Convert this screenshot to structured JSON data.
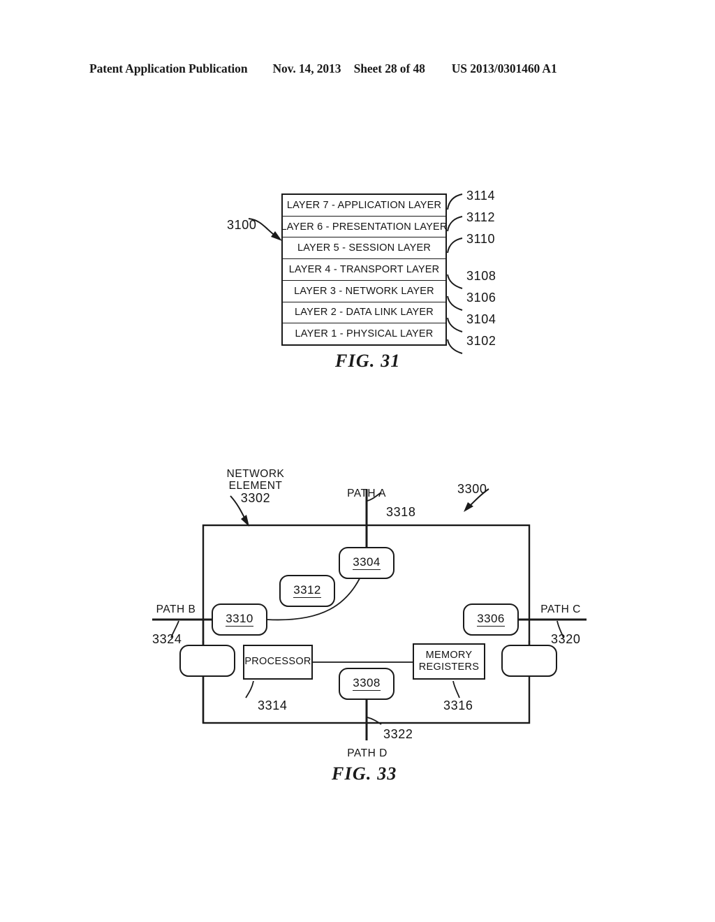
{
  "header": {
    "left": "Patent Application Publication",
    "date": "Nov. 14, 2013",
    "sheet": "Sheet 28 of 48",
    "number": "US 2013/0301460 A1"
  },
  "fig31": {
    "caption": "FIG. 31",
    "stack_ref": "3100",
    "layers": [
      {
        "label": "LAYER 7 - APPLICATION LAYER",
        "ref": "3114"
      },
      {
        "label": "LAYER 6 - PRESENTATION LAYER",
        "ref": "3112"
      },
      {
        "label": "LAYER 5 - SESSION LAYER",
        "ref": "3110"
      },
      {
        "label": "LAYER 4 - TRANSPORT LAYER",
        "ref": "3108"
      },
      {
        "label": "LAYER 3 - NETWORK LAYER",
        "ref": "3106"
      },
      {
        "label": "LAYER 2 - DATA LINK LAYER",
        "ref": "3104"
      },
      {
        "label": "LAYER 1 - PHYSICAL LAYER",
        "ref": "3102"
      }
    ]
  },
  "fig33": {
    "caption": "FIG. 33",
    "system_ref": "3300",
    "network_element": {
      "line1": "NETWORK",
      "line2": "ELEMENT",
      "ref": "3302"
    },
    "nodes": {
      "top": "3304",
      "right": "3306",
      "bottom": "3308",
      "left": "3310",
      "center": "3312"
    },
    "blocks": {
      "processor": {
        "label": "PROCESSOR",
        "ref": "3314"
      },
      "memory": {
        "line1": "MEMORY",
        "line2": "REGISTERS",
        "ref": "3316"
      }
    },
    "paths": [
      {
        "label": "PATH A",
        "ref": "3318"
      },
      {
        "label": "PATH B",
        "ref": "3324"
      },
      {
        "label": "PATH C",
        "ref": "3320"
      },
      {
        "label": "PATH D",
        "ref": "3322"
      }
    ]
  }
}
